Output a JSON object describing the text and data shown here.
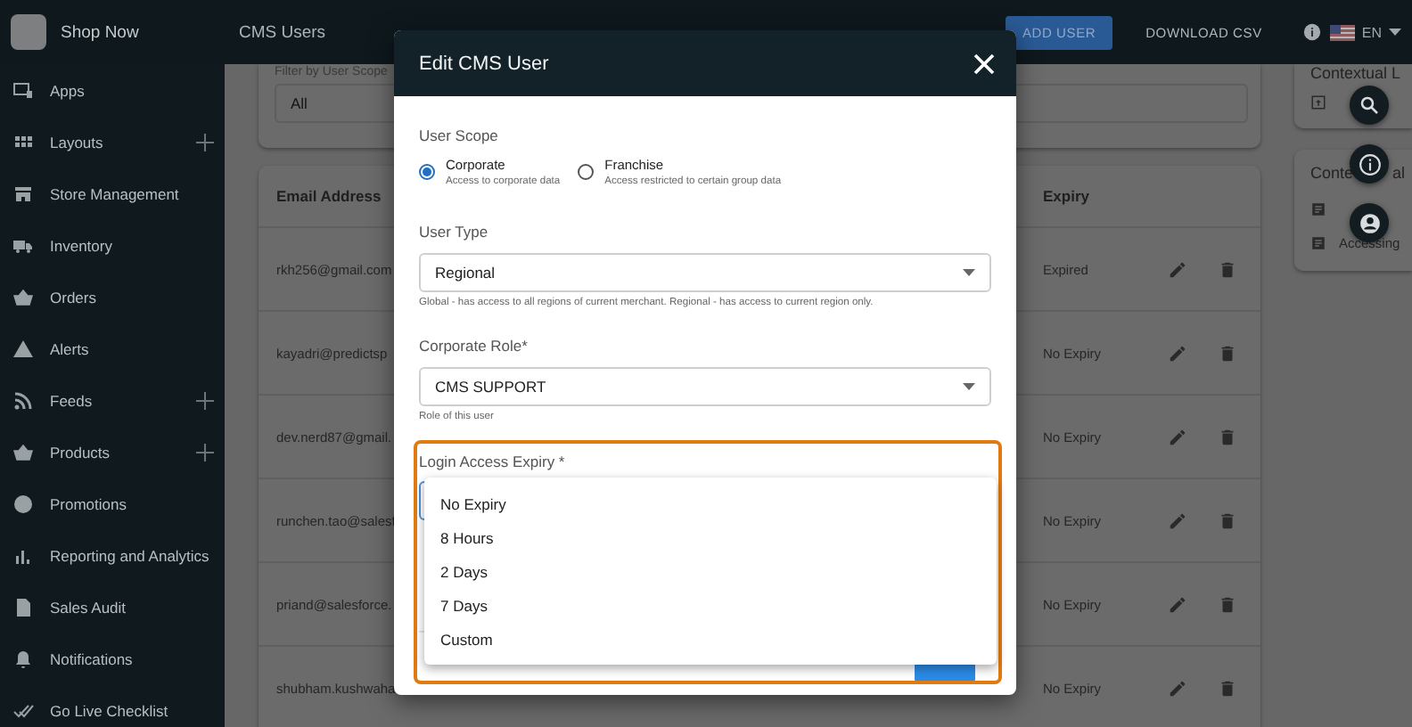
{
  "app": {
    "name": "Shop Now"
  },
  "page_title": "CMS Users",
  "actions": [
    {
      "label": "ADD USER",
      "kind": "primary"
    },
    {
      "label": "DOWNLOAD CSV",
      "kind": "text"
    }
  ],
  "language": "EN",
  "sidebar": {
    "items": [
      {
        "label": "Apps",
        "expandable": false
      },
      {
        "label": "Layouts",
        "expandable": true
      },
      {
        "label": "Store Management",
        "expandable": false
      },
      {
        "label": "Inventory",
        "expandable": false
      },
      {
        "label": "Orders",
        "expandable": false
      },
      {
        "label": "Alerts",
        "expandable": false
      },
      {
        "label": "Feeds",
        "expandable": true
      },
      {
        "label": "Products",
        "expandable": true
      },
      {
        "label": "Promotions",
        "expandable": false
      },
      {
        "label": "Reporting and Analytics",
        "expandable": false
      },
      {
        "label": "Sales Audit",
        "expandable": false
      },
      {
        "label": "Notifications",
        "expandable": false
      },
      {
        "label": "Go Live Checklist",
        "expandable": false
      }
    ]
  },
  "filter": {
    "label": "Filter by User Scope",
    "value": "All"
  },
  "table": {
    "columns": [
      "Email Address",
      "Expiry"
    ],
    "rows": [
      {
        "email": "rkh256@gmail.com",
        "expiry": "Expired"
      },
      {
        "email": "kayadri@predictsp",
        "expiry": "No Expiry"
      },
      {
        "email": "dev.nerd87@gmail.",
        "expiry": "No Expiry"
      },
      {
        "email": "runchen.tao@salesf",
        "expiry": "No Expiry"
      },
      {
        "email": "priand@salesforce.",
        "expiry": "No Expiry"
      },
      {
        "email": "shubham.kushwaha",
        "expiry": "No Expiry"
      }
    ]
  },
  "contextual": [
    {
      "title_parts": [
        "Contextual L"
      ],
      "items": [
        {
          "kind": "covered"
        }
      ]
    },
    {
      "title_parts": [
        "Conte",
        "al"
      ],
      "items": [
        {
          "kind": "covered"
        },
        {
          "kind": "link",
          "label": "Accessing"
        }
      ]
    }
  ],
  "dialog": {
    "title": "Edit CMS User",
    "scope": {
      "label": "User Scope",
      "options": [
        {
          "label": "Corporate",
          "description": "Access to corporate data",
          "selected": true
        },
        {
          "label": "Franchise",
          "description": "Access restricted to certain group data",
          "selected": false
        }
      ]
    },
    "user_type": {
      "label": "User Type",
      "value": "Regional",
      "helper": "Global - has access to all regions of current merchant. Regional - has access to current region only."
    },
    "role": {
      "label": "Corporate Role*",
      "value": "CMS SUPPORT",
      "helper": "Role of this user"
    },
    "expiry": {
      "label": "Login Access Expiry *",
      "highlighted": true,
      "options": [
        "No Expiry",
        "8 Hours",
        "2 Days",
        "7 Days",
        "Custom"
      ]
    }
  }
}
